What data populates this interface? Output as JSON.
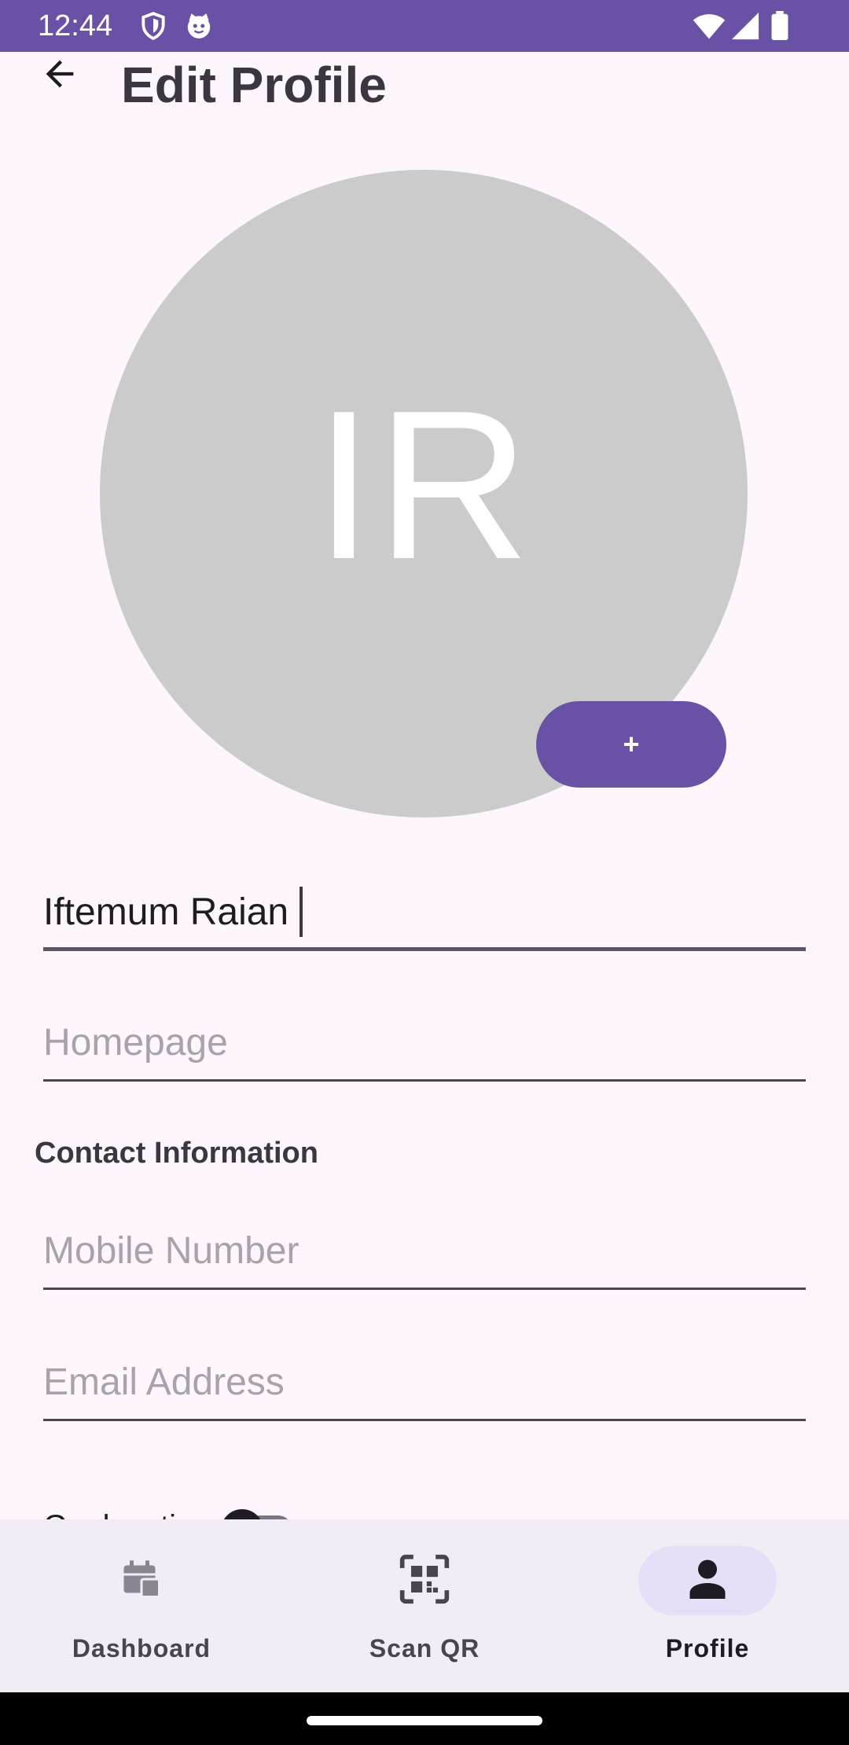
{
  "status_bar": {
    "time": "12:44",
    "left_icons": [
      "shield-icon",
      "cat-icon"
    ],
    "right_icons": [
      "wifi-icon",
      "signal-icon",
      "battery-icon"
    ],
    "background_color": "#6951A5"
  },
  "header": {
    "title": "Edit Profile",
    "back_icon": "arrow-back-icon"
  },
  "avatar": {
    "initials": "IR",
    "background_color": "#CBCBCB",
    "add_button_label": "+"
  },
  "form": {
    "name_value": "Iftemum Raian",
    "homepage_placeholder": "Homepage",
    "section_contact": "Contact Information",
    "mobile_placeholder": "Mobile Number",
    "email_placeholder": "Email Address",
    "partially_visible_label": "Geolocation"
  },
  "bottom_nav": {
    "items": [
      {
        "label": "Dashboard",
        "icon": "dashboard-calendar-icon",
        "active": false
      },
      {
        "label": "Scan QR",
        "icon": "qr-scan-icon",
        "active": false
      },
      {
        "label": "Profile",
        "icon": "person-icon",
        "active": true
      }
    ]
  },
  "colors": {
    "accent": "#6951A5",
    "page_background": "#FDF7FD",
    "nav_background": "#F2EDF5",
    "nav_active_pill": "#E7DEF7"
  }
}
